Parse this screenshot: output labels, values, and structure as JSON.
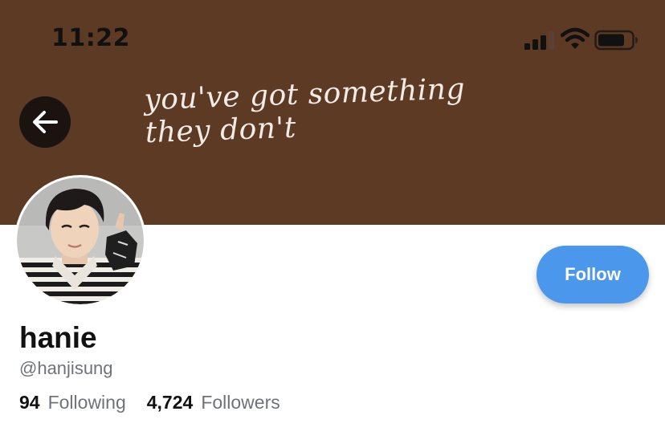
{
  "status_bar": {
    "time": "11:22"
  },
  "header": {
    "banner_tagline": "you've got something they don't",
    "banner_color": "#5d3a24",
    "back_icon": "arrow-left-icon"
  },
  "profile": {
    "display_name": "hanie",
    "handle": "@hanjisung",
    "follow_label": "Follow",
    "follow_color": "#4a97eb"
  },
  "stats": {
    "following_count": "94",
    "following_label": "Following",
    "followers_count": "4,724",
    "followers_label": "Followers"
  }
}
